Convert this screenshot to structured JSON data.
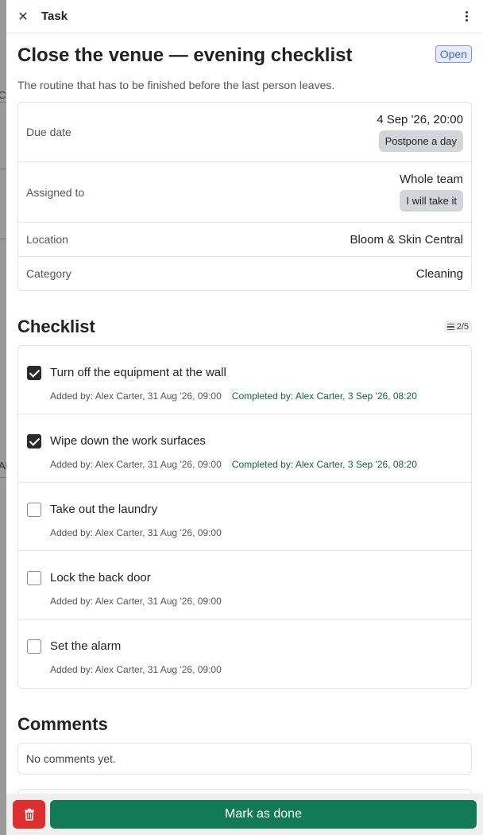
{
  "backdrop": {
    "fragment_top": "Co",
    "fragment_mid": "Al"
  },
  "topbar": {
    "title": "Task",
    "close_icon": "close-icon",
    "more_icon": "kebab-menu-icon"
  },
  "task": {
    "title": "Close the venue — evening checklist",
    "status": "Open",
    "description": "The routine that has to be finished before the last person leaves."
  },
  "details": {
    "due_label": "Due date",
    "due_value": "4 Sep '26, 20:00",
    "postpone_label": "Postpone a day",
    "assigned_label": "Assigned to",
    "assigned_value": "Whole team",
    "take_label": "I will take it",
    "location_label": "Location",
    "location_value": "Bloom & Skin Central",
    "category_label": "Category",
    "category_value": "Cleaning"
  },
  "checklist": {
    "title": "Checklist",
    "count": "2/5",
    "items": [
      {
        "text": "Turn off the equipment at the wall",
        "checked": true,
        "added": "Added by: Alex Carter, 31 Aug '26, 09:00",
        "completed": "Completed by: Alex Carter, 3 Sep '26, 08:20"
      },
      {
        "text": "Wipe down the work surfaces",
        "checked": true,
        "added": "Added by: Alex Carter, 31 Aug '26, 09:00",
        "completed": "Completed by: Alex Carter, 3 Sep '26, 08:20"
      },
      {
        "text": "Take out the laundry",
        "checked": false,
        "added": "Added by: Alex Carter, 31 Aug '26, 09:00",
        "completed": ""
      },
      {
        "text": "Lock the back door",
        "checked": false,
        "added": "Added by: Alex Carter, 31 Aug '26, 09:00",
        "completed": ""
      },
      {
        "text": "Set the alarm",
        "checked": false,
        "added": "Added by: Alex Carter, 31 Aug '26, 09:00",
        "completed": ""
      }
    ]
  },
  "comments": {
    "title": "Comments",
    "empty": "No comments yet."
  },
  "footer": {
    "done_label": "Mark as done",
    "delete_icon": "trash-icon"
  },
  "colors": {
    "accent_green": "#137a58",
    "danger_red": "#dc3030",
    "status_blue": "#4a68c7"
  }
}
